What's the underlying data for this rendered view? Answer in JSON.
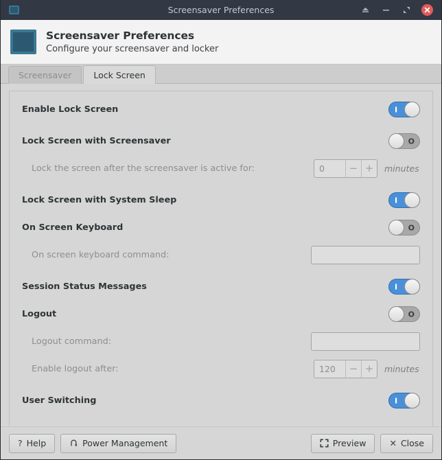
{
  "titlebar": {
    "title": "Screensaver Preferences",
    "icon": "app-window-icon",
    "buttons": [
      {
        "name": "shade-button",
        "icon": "eject-icon"
      },
      {
        "name": "minimize-button",
        "icon": "minimize-icon"
      },
      {
        "name": "maximize-button",
        "icon": "maximize-icon"
      },
      {
        "name": "close-button",
        "icon": "close-icon"
      }
    ]
  },
  "header": {
    "icon": "screensaver-monitor-icon",
    "title": "Screensaver Preferences",
    "subtitle": "Configure your screensaver and locker"
  },
  "tabs": [
    {
      "label": "Screensaver",
      "active": false
    },
    {
      "label": "Lock Screen",
      "active": true
    }
  ],
  "settings": {
    "enable_lock_screen": {
      "label": "Enable Lock Screen",
      "state": "on",
      "mark": "I"
    },
    "lock_with_screensaver": {
      "label": "Lock Screen with Screensaver",
      "state": "off",
      "mark": "O"
    },
    "lock_delay": {
      "label": "Lock the screen after the screensaver is active for:",
      "value": "0",
      "minus": "−",
      "plus": "+",
      "units": "minutes"
    },
    "lock_with_system_sleep": {
      "label": "Lock Screen with System Sleep",
      "state": "on",
      "mark": "I"
    },
    "on_screen_keyboard": {
      "label": "On Screen Keyboard",
      "state": "off",
      "mark": "O"
    },
    "keyboard_command": {
      "label": "On screen keyboard command:",
      "value": ""
    },
    "session_status_messages": {
      "label": "Session Status Messages",
      "state": "on",
      "mark": "I"
    },
    "logout": {
      "label": "Logout",
      "state": "off",
      "mark": "O"
    },
    "logout_command": {
      "label": "Logout command:",
      "value": ""
    },
    "logout_delay": {
      "label": "Enable logout after:",
      "value": "120",
      "minus": "−",
      "plus": "+",
      "units": "minutes"
    },
    "user_switching": {
      "label": "User Switching",
      "state": "on",
      "mark": "I"
    }
  },
  "bottom_bar": {
    "help": {
      "label": "Help",
      "icon": "question-mark-icon",
      "glyph": "?"
    },
    "power_management": {
      "label": "Power Management",
      "icon": "rotate-arrow-icon"
    },
    "preview": {
      "label": "Preview",
      "icon": "fullscreen-corners-icon"
    },
    "close": {
      "label": "Close",
      "icon": "x-icon",
      "glyph": "✕"
    }
  },
  "colors": {
    "titlebar_bg": "#323844",
    "close_button": "#e05c5c",
    "toggle_on": "#4a90d9",
    "toggle_off": "#a8a8a8",
    "panel_bg": "#d6d6d6",
    "header_bg": "#f3f3f3",
    "app_icon": "#2c5871"
  }
}
